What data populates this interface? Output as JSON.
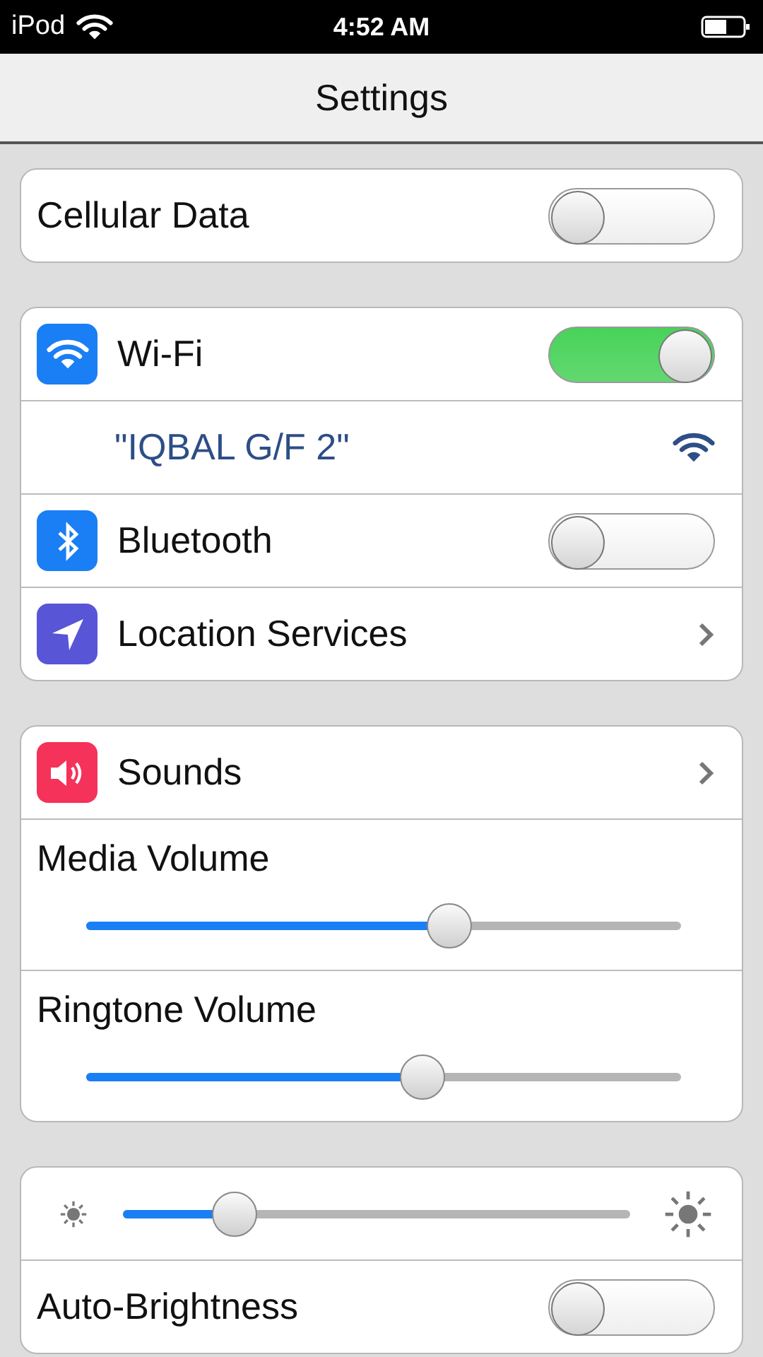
{
  "status_bar": {
    "carrier": "iPod",
    "time": "4:52 AM"
  },
  "nav_bar": {
    "title": "Settings"
  },
  "groups": [
    {
      "rows": [
        {
          "kind": "toggle",
          "label": "Cellular Data",
          "on": false
        }
      ]
    },
    {
      "rows": [
        {
          "kind": "toggle",
          "color": "#1a7ef5",
          "label": "Wi-Fi",
          "on": true
        },
        {
          "kind": "network",
          "label": "\"IQBAL G/F 2\""
        },
        {
          "kind": "toggle",
          "color": "#1a7ef5",
          "label": "Bluetooth",
          "on": false
        },
        {
          "kind": "link",
          "color": "#5856d6",
          "label": "Location Services"
        }
      ]
    },
    {
      "rows": [
        {
          "kind": "link",
          "color": "#f5325a",
          "label": "Sounds"
        },
        {
          "kind": "slider",
          "label": "Media Volume",
          "level": 0.61
        },
        {
          "kind": "slider",
          "label": "Ringtone Volume",
          "level": 0.565
        }
      ]
    },
    {
      "rows": [
        {
          "kind": "brightness",
          "level": 0.22
        },
        {
          "kind": "toggle",
          "label": "Auto-Brightness",
          "on": false
        }
      ]
    }
  ]
}
